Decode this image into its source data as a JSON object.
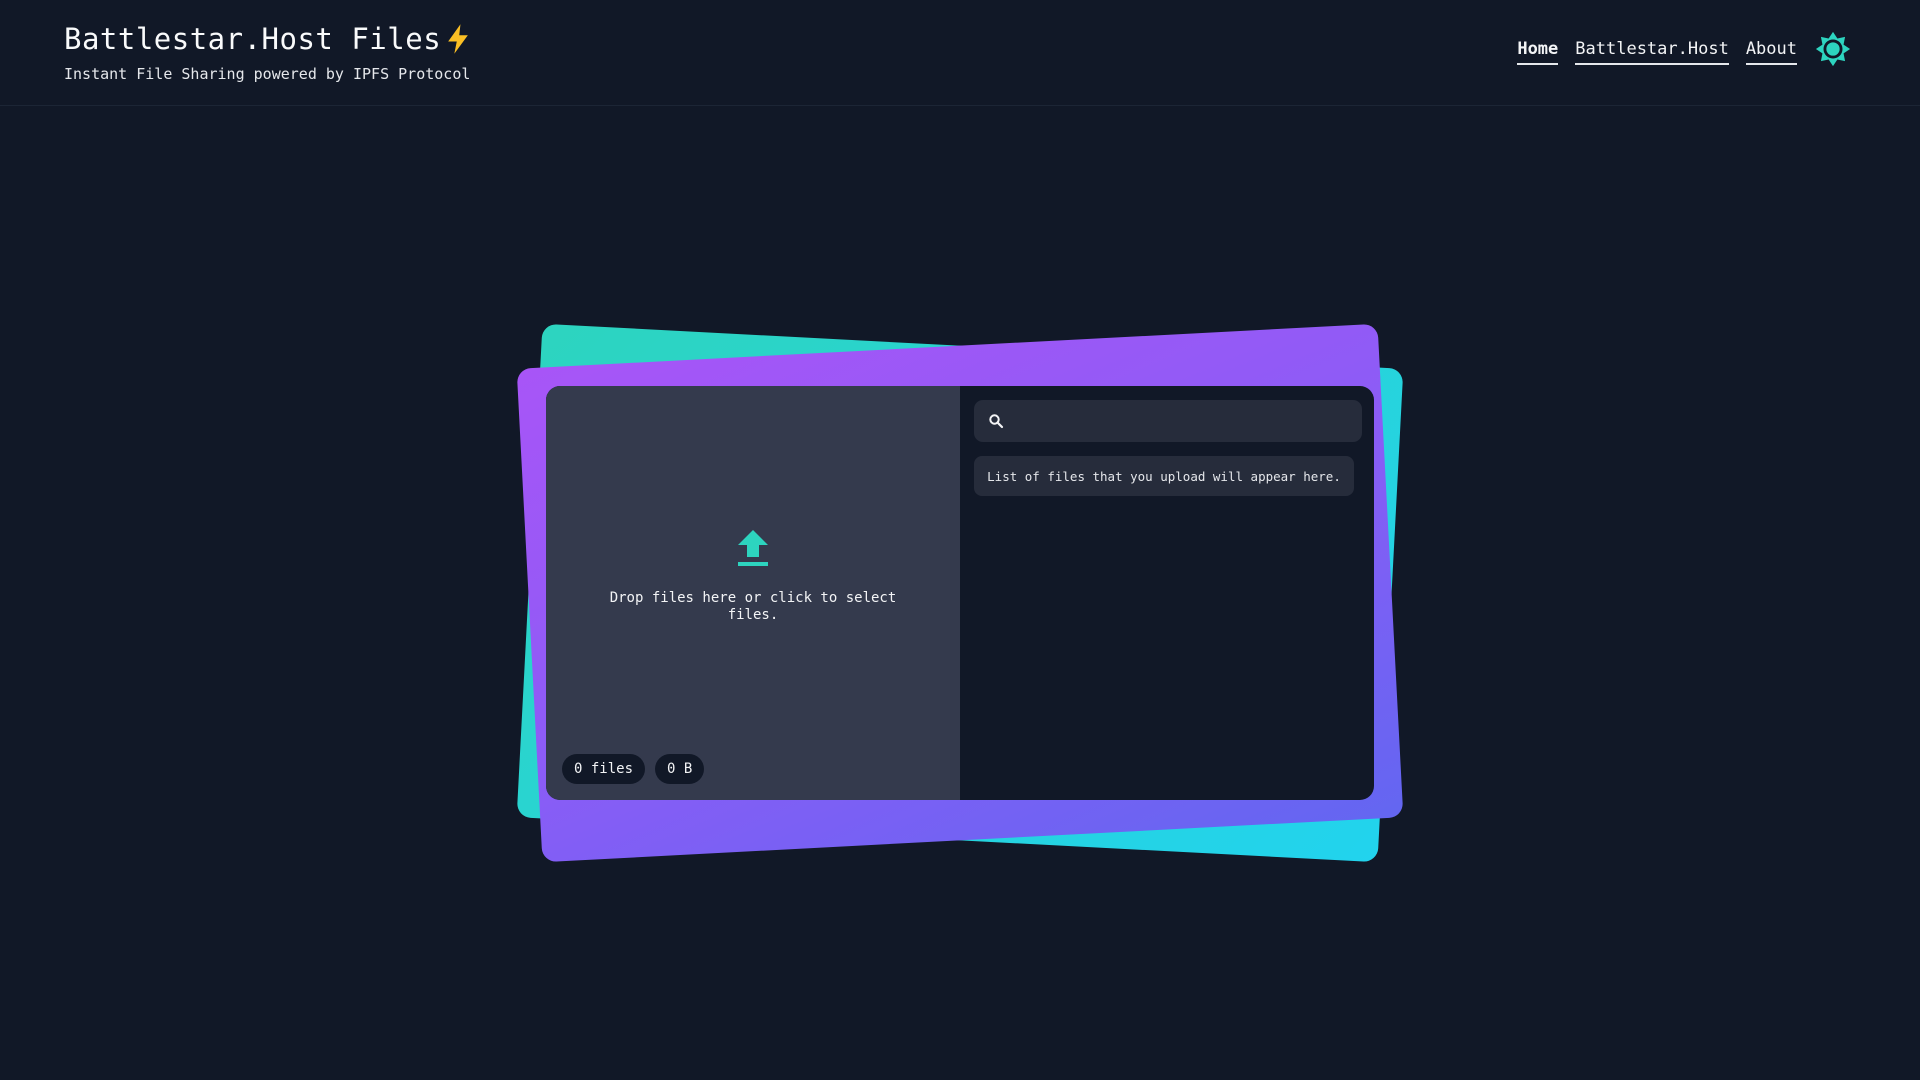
{
  "header": {
    "title": "Battlestar.Host Files",
    "subtitle": "Instant File Sharing powered by IPFS Protocol",
    "title_icon": "lightning-bolt-icon"
  },
  "nav": {
    "items": [
      {
        "label": "Home",
        "active": true
      },
      {
        "label": "Battlestar.Host",
        "active": false
      },
      {
        "label": "About",
        "active": false
      }
    ],
    "theme_toggle_icon": "sun-icon"
  },
  "uploader": {
    "drop_text": "Drop files here or click to select files.",
    "file_count": "0 files",
    "total_size": "0 B",
    "icon": "upload-icon"
  },
  "file_list": {
    "search_placeholder": "",
    "empty_message": "List of files that you upload will appear here.",
    "search_icon": "search-icon"
  },
  "colors": {
    "background": "#111827",
    "accent_teal": "#2dd4bf",
    "accent_purple": "#a855f7",
    "accent_indigo": "#6366f1",
    "dropzone": "#343a4d",
    "bolt": "#fbbf24"
  }
}
